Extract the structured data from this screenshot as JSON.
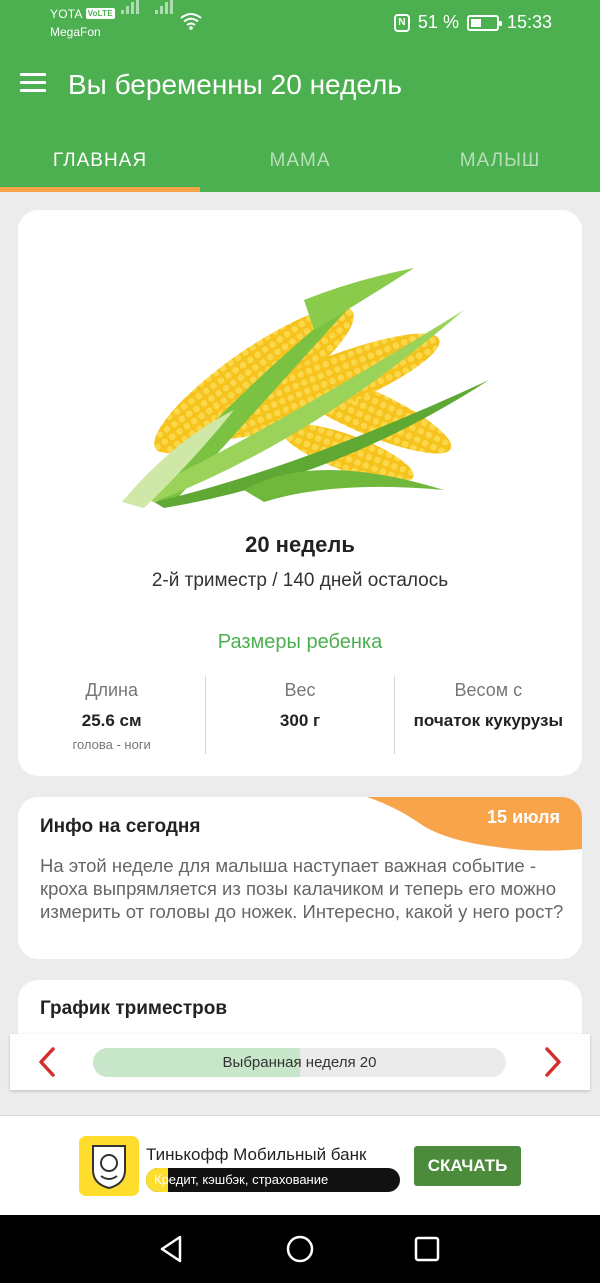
{
  "status_bar": {
    "carrier_1": "YOTA",
    "volte": "VoLTE",
    "carrier_2": "MegaFon",
    "battery_percent": "51 %",
    "time": "15:33",
    "nfc_label": "N",
    "battery_level": 0.51,
    "icons": [
      "signal-icon",
      "signal-icon",
      "wifi-icon",
      "nfc-icon",
      "battery-icon"
    ]
  },
  "app_bar": {
    "title": "Вы беременны 20 недель",
    "menu_icon": "hamburger-menu-icon"
  },
  "tabs": [
    {
      "label": "ГЛАВНАЯ",
      "active": true
    },
    {
      "label": "МАМА",
      "active": false
    },
    {
      "label": "МАЛЫШ",
      "active": false
    }
  ],
  "main_card": {
    "image": "corn-cobs-illustration",
    "week_title": "20 недель",
    "trimester_line": "2-й триместр / 140 дней осталось",
    "sizes_link": "Размеры ребенка",
    "stats": [
      {
        "label": "Длина",
        "value": "25.6 см",
        "note": "голова - ноги"
      },
      {
        "label": "Вес",
        "value": "300 г",
        "note": ""
      },
      {
        "label": "Весом с",
        "value": "початок кукурузы",
        "note": ""
      }
    ]
  },
  "info_card": {
    "title": "Инфо на сегодня",
    "date": "15 июля",
    "body": "На этой неделе для малыша наступает важная событие - кроха выпрямляется из позы калачиком и теперь его можно измерить от головы до ножек. Интересно, какой у него рост?"
  },
  "trimester_card": {
    "title": "График триместров"
  },
  "week_selector": {
    "label": "Выбранная неделя 20",
    "progress": 0.5,
    "prev_icon": "chevron-left-icon",
    "next_icon": "chevron-right-icon"
  },
  "ad": {
    "title": "Тинькофф Мобильный банк",
    "subtitle": "Кредит, кэшбэк, страхование",
    "button": "СКАЧАТЬ",
    "logo": "tinkoff-logo"
  },
  "colors": {
    "primary_green": "#4caf50",
    "accent_orange": "#f7a44b",
    "progress_fill": "#c8e6c9",
    "arrow_red": "#d32f2f",
    "ad_button": "#4c8a3c",
    "ad_yellow": "#ffdd2d"
  }
}
